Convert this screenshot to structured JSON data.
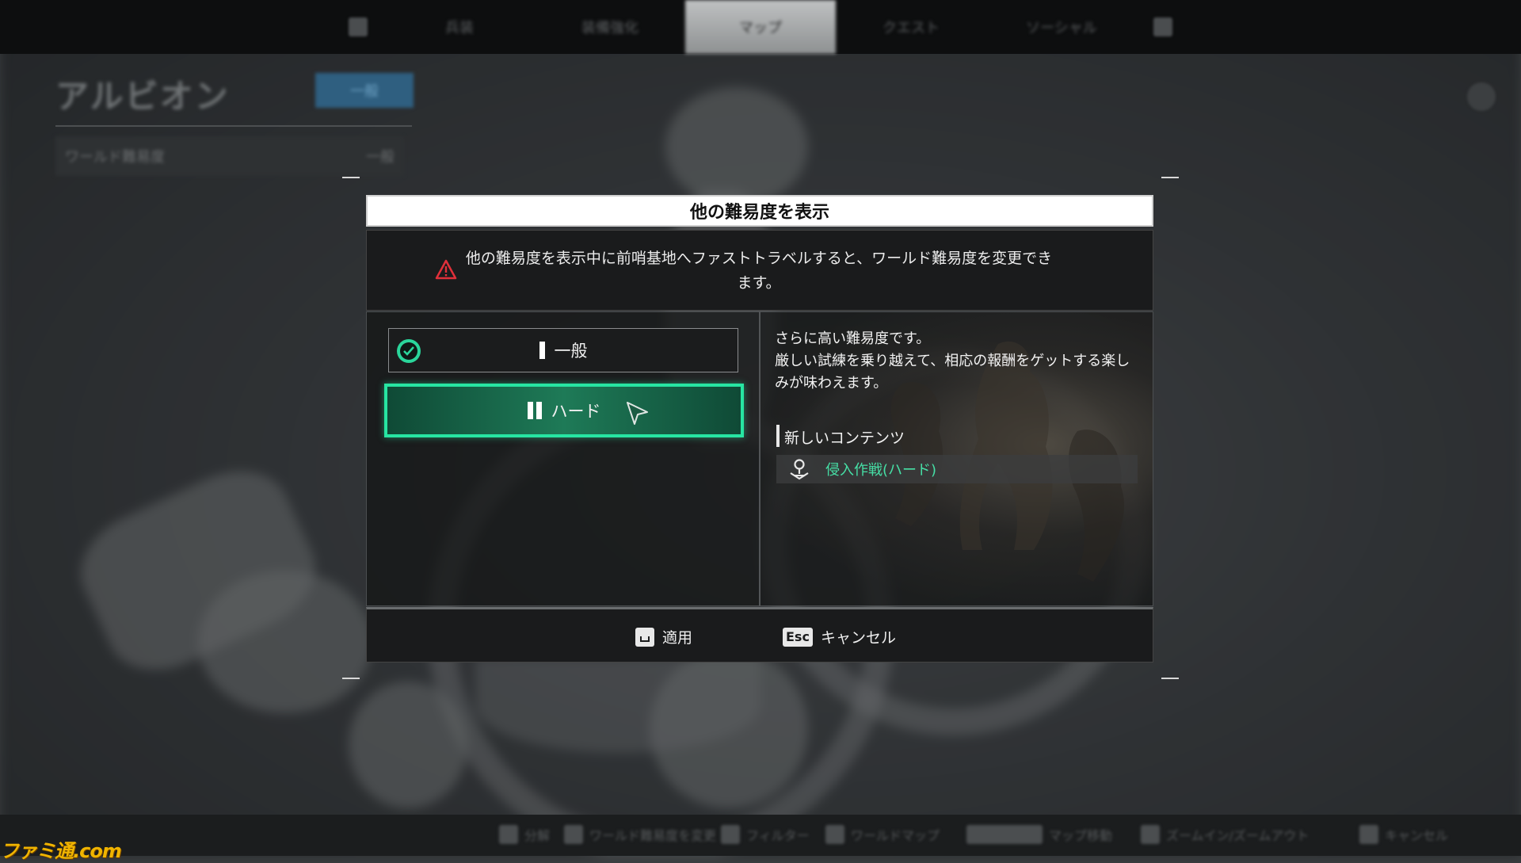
{
  "topnav": {
    "tabs": [
      {
        "label": "兵装"
      },
      {
        "label": "装備強化"
      },
      {
        "label": "マップ"
      },
      {
        "label": "クエスト"
      },
      {
        "label": "ソーシャル"
      }
    ]
  },
  "region": {
    "name": "アルビオン",
    "badge": "一般",
    "world_difficulty_label": "ワールド難易度",
    "world_difficulty_value": "一般"
  },
  "dialog": {
    "title": "他の難易度を表示",
    "warning_text": "他の難易度を表示中に前哨基地へファストトラベルすると、ワールド難易度を変更できます。",
    "options": [
      {
        "label": "一般",
        "selected_check": true
      },
      {
        "label": "ハード",
        "focused": true
      }
    ],
    "description": "さらに高い難易度です。\n厳しい試練を乗り越えて、相応の報酬をゲットする楽しみが味わえます。",
    "new_content_label": "新しいコンテンツ",
    "new_content_items": [
      {
        "label": "侵入作戦(ハード)",
        "icon": "pin-icon"
      }
    ],
    "footer": {
      "apply_label": "適用",
      "cancel_key": "Esc",
      "cancel_label": "キャンセル"
    }
  },
  "hintbar": {
    "items": [
      "分解",
      "ワールド難易度を変更",
      "フィルター",
      "ワールドマップ",
      "マップ移動",
      "ズームイン/ズームアウト",
      "キャンセル"
    ]
  },
  "watermark": "ファミ通.com",
  "colors": {
    "accent": "#27e5a2",
    "warning": "#e0303a",
    "title_bg": "#ffffff",
    "panel_bg": "#1a1b1c"
  }
}
